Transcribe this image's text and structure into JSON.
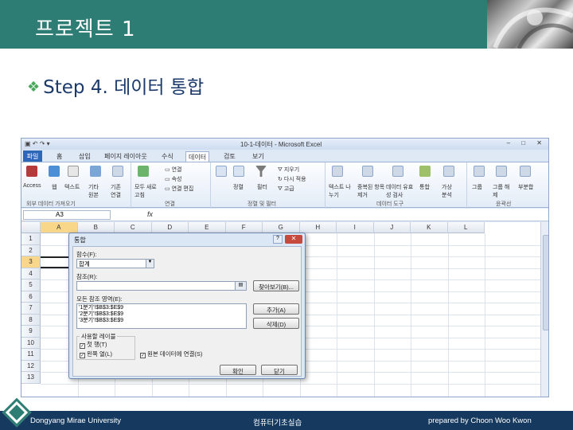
{
  "slide": {
    "title": "프로젝트 1",
    "subtitle_bullet": "❖",
    "subtitle": "Step 4. 데이터 통합"
  },
  "footer": {
    "left": "Dongyang Mirae University",
    "center": "컴퓨터기초실습",
    "right": "prepared by Choon Woo Kwon"
  },
  "excel": {
    "window_title": "10-1-데이터 - Microsoft Excel",
    "window_buttons": "– □ ✕",
    "tabs": [
      "파일",
      "홈",
      "삽입",
      "페이지 레이아웃",
      "수식",
      "데이터",
      "검토",
      "보기"
    ],
    "active_tab": "데이터",
    "ribbon": {
      "access": "Access",
      "web": "웹",
      "text": "텍스트",
      "other_sources": "기타 원본",
      "existing": "기존 연결",
      "refresh_all": "모두 새로 고침",
      "connections": "연결",
      "properties": "속성",
      "edit_links": "연결 편집",
      "sort": "정렬",
      "filter": "필터",
      "clear": "지우기",
      "reapply": "다시 적용",
      "advanced": "고급",
      "text_to_columns": "텍스트 나누기",
      "remove_duplicates": "중복된 항목 제거",
      "data_validation": "데이터 유효성 검사",
      "consolidate": "통합",
      "what_if": "가상 분석",
      "group": "그룹",
      "ungroup": "그룹 해제",
      "subtotal": "부분합",
      "group_external": "외부 데이터 가져오기",
      "group_connections": "연결",
      "group_sort_filter": "정렬 및 필터",
      "group_data_tools": "데이터 도구",
      "group_outline": "윤곽선"
    },
    "name_box": "A3",
    "fx": "fx",
    "columns": [
      "A",
      "B",
      "C",
      "D",
      "E",
      "F",
      "G",
      "H",
      "I",
      "J",
      "K",
      "L"
    ],
    "rows": [
      "1",
      "2",
      "3",
      "4",
      "5",
      "6",
      "7",
      "8",
      "9",
      "10",
      "11",
      "12",
      "13"
    ],
    "selected_column": "A",
    "selected_row": "3"
  },
  "dialog": {
    "title": "통합",
    "help": "?",
    "close": "✕",
    "function_label": "함수(F):",
    "function_value": "합계",
    "reference_label": "참조(R):",
    "reference_value": "",
    "browse_button": "찾아보기(B)...",
    "all_refs_label": "모든 참조 영역(E):",
    "all_refs": [
      "'1분기'!$B$3:$E$9",
      "'2분기'!$B$3:$E$9",
      "'3분기'!$B$3:$E$9"
    ],
    "add_button": "추가(A)",
    "delete_button": "삭제(D)",
    "use_labels_label": "사용할 레이블",
    "top_row": "첫 행(T)",
    "left_column": "왼쪽 열(L)",
    "create_links": "원본 데이터에 연결(S)",
    "ok": "확인",
    "close_button": "닫기"
  }
}
